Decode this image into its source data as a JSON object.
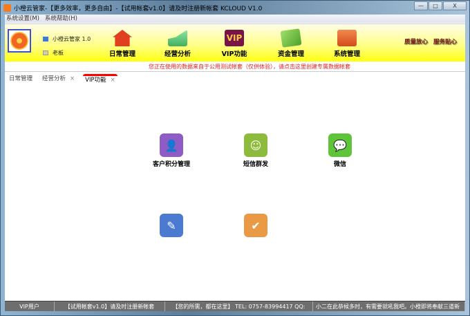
{
  "window": {
    "title": "小橙云管家-【更多效率，更多自由】-【试用帐套v1.0】请及时注册新帐套  KCLOUD V1.0",
    "min": "—",
    "max": "□",
    "close": "X"
  },
  "menu": [
    "系统设置(M)",
    "系统帮助(H)"
  ],
  "user": {
    "app": "小橙云管家 1.0",
    "role": "老板"
  },
  "toolbar": [
    {
      "label": "日常管理",
      "icon": "house-icon",
      "color": "#e04020"
    },
    {
      "label": "经营分析",
      "icon": "chart-icon",
      "color": "#5fcf7a"
    },
    {
      "label": "VIP功能",
      "icon": "vip-icon",
      "color": "#7a1448"
    },
    {
      "label": "资金管理",
      "icon": "money-icon",
      "color": "#7bc043"
    },
    {
      "label": "系统管理",
      "icon": "folder-icon",
      "color": "#e8622a"
    }
  ],
  "quick_links": [
    "质量放心",
    "服务贴心"
  ],
  "notice": "您正在使用的数据来自于公用测试帐套（仅供体验），请点击这里创建专属数据帐套",
  "tabs": [
    {
      "label": "日常管理",
      "closable": false
    },
    {
      "label": "经营分析",
      "closable": true
    },
    {
      "label": "VIP功能",
      "closable": true,
      "active": true
    }
  ],
  "tab_close": "×",
  "functions": [
    {
      "label": "客户积分管理",
      "icon": "user-add-icon",
      "color": "#8e5cc4"
    },
    {
      "label": "短信群发",
      "icon": "sms-icon",
      "color": "#8dbb3c"
    },
    {
      "label": "微信",
      "icon": "wechat-icon",
      "color": "#5ec43a"
    },
    {
      "label": "",
      "icon": "notepad-icon",
      "color": "#4a7bd0"
    },
    {
      "label": "",
      "icon": "clipboard-check-icon",
      "color": "#ea9a45"
    }
  ],
  "status": [
    "VIP用户",
    "【试用帐套v1.0】请及时注册新帐套",
    "【您的所需，都在这里】 TEL: 0757-83994417  QQ:",
    "小二在此恭候多时，有需要就吼我吧。小橙即将奉献三道新"
  ]
}
